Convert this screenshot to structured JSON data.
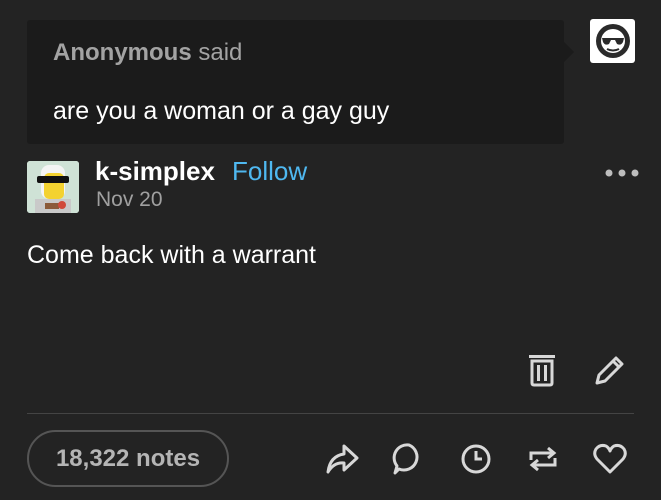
{
  "ask": {
    "asker_name": "Anonymous",
    "asker_suffix": "said",
    "question": "are you a woman or a gay guy",
    "avatar_icon": "sunglasses-face-icon"
  },
  "post": {
    "username": "k-simplex",
    "follow_label": "Follow",
    "date": "Nov 20",
    "body": "Come back with a warrant",
    "more_icon": "ellipsis-icon"
  },
  "edit_actions": [
    {
      "icon": "trash-icon"
    },
    {
      "icon": "pencil-icon"
    }
  ],
  "footer": {
    "notes_label": "18,322 notes",
    "actions": [
      {
        "icon": "share-icon"
      },
      {
        "icon": "reply-icon"
      },
      {
        "icon": "clock-icon"
      },
      {
        "icon": "reblog-icon"
      },
      {
        "icon": "heart-icon"
      }
    ]
  },
  "colors": {
    "background": "#232323",
    "ask_bubble": "#1b1b1b",
    "follow_link": "#4fb8f0",
    "muted_text": "#a3a3a3",
    "icon": "#d8d8d8"
  }
}
